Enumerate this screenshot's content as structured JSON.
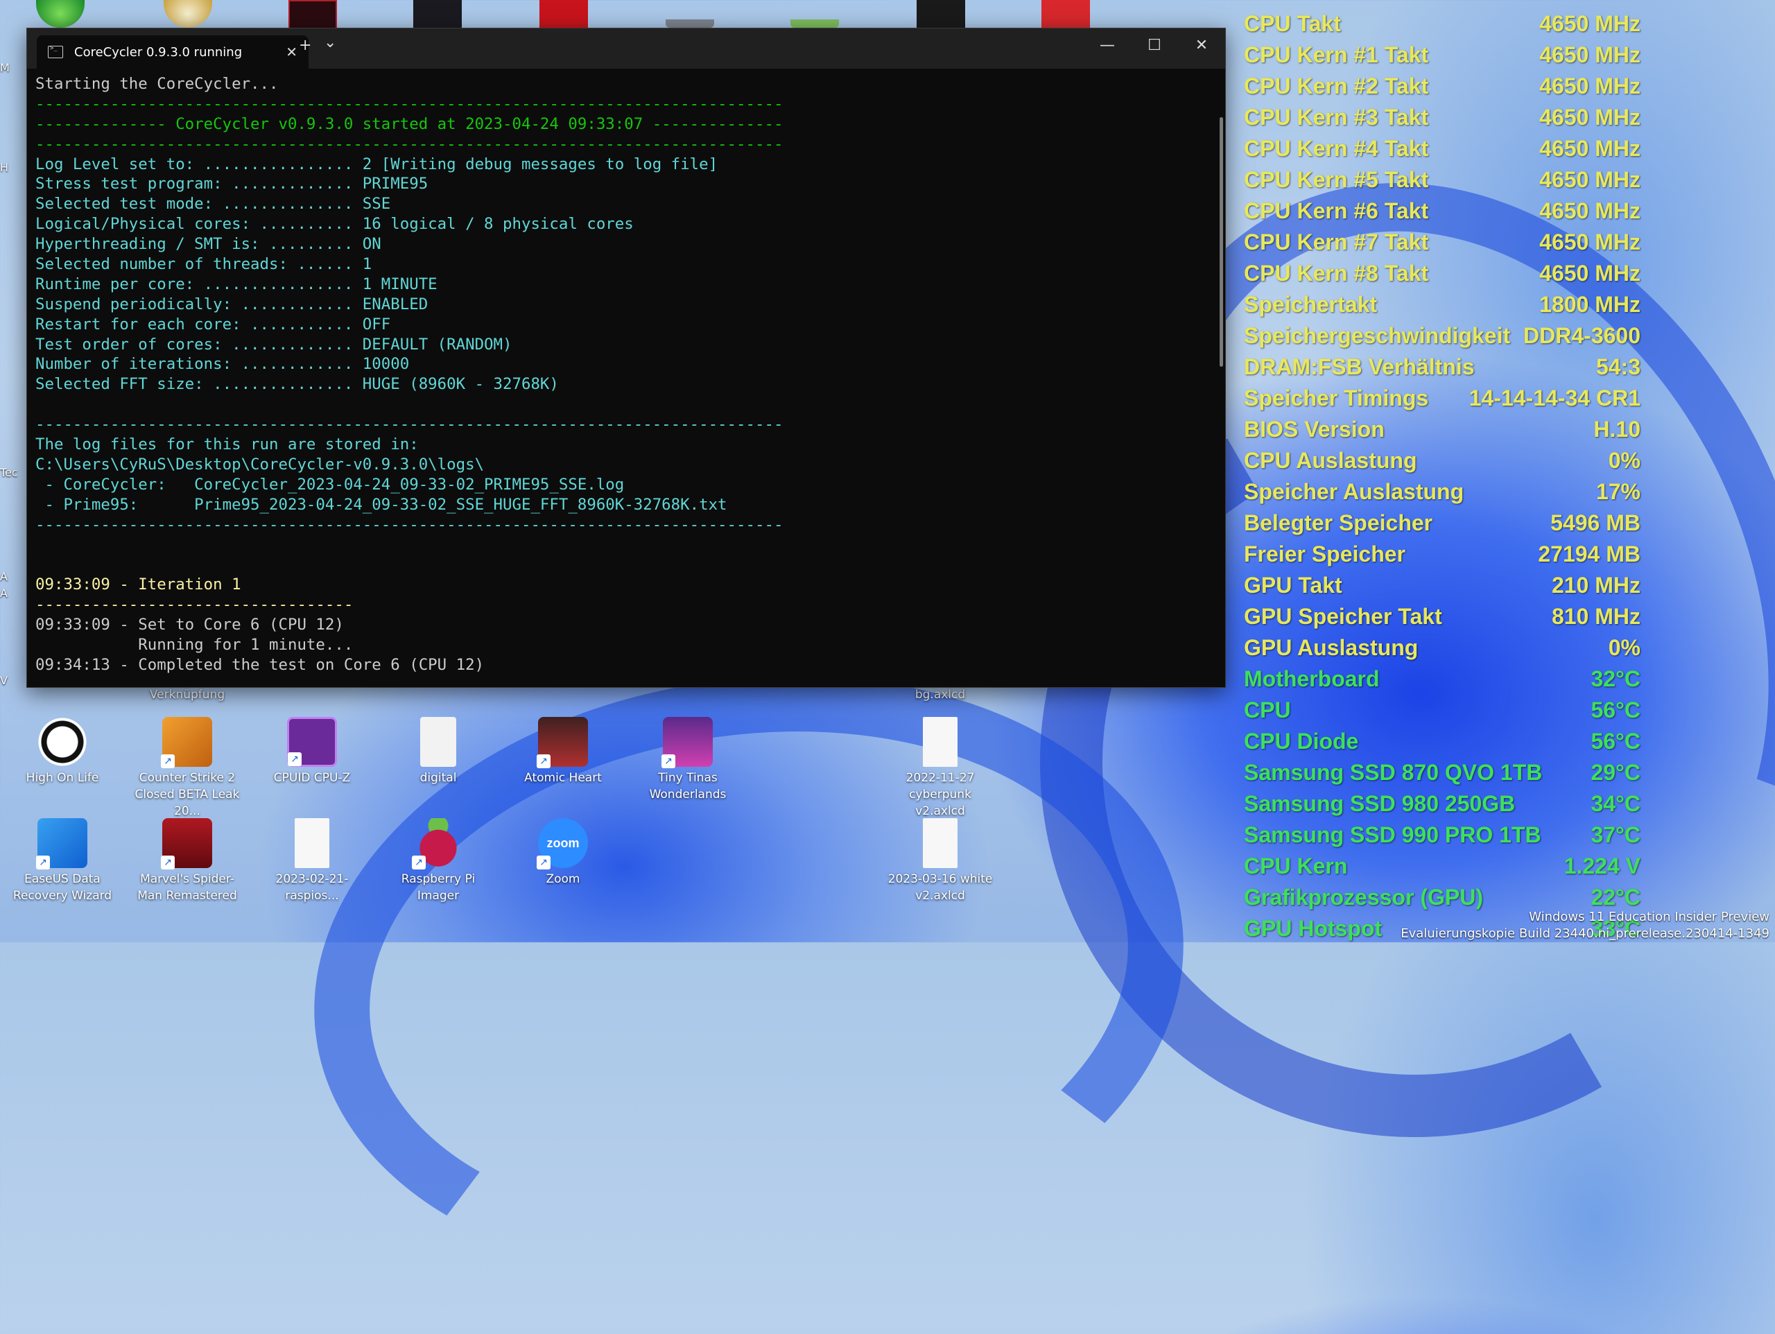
{
  "terminal": {
    "tab_title": "CoreCycler 0.9.3.0 running",
    "new_tab": "+",
    "dropdown": "⌄",
    "close_tab": "✕",
    "minimize": "—",
    "maximize": "☐",
    "close": "✕",
    "lines": [
      {
        "cls": "w",
        "text": "Starting the CoreCycler..."
      },
      {
        "cls": "g",
        "text": "--------------------------------------------------------------------------------"
      },
      {
        "cls": "g",
        "text": "-------------- CoreCycler v0.9.3.0 started at 2023-04-24 09:33:07 --------------"
      },
      {
        "cls": "g",
        "text": "--------------------------------------------------------------------------------"
      },
      {
        "cls": "c",
        "text": "Log Level set to: ................ 2 [Writing debug messages to log file]"
      },
      {
        "cls": "c",
        "text": "Stress test program: ............. PRIME95"
      },
      {
        "cls": "c",
        "text": "Selected test mode: .............. SSE"
      },
      {
        "cls": "c",
        "text": "Logical/Physical cores: .......... 16 logical / 8 physical cores"
      },
      {
        "cls": "c",
        "text": "Hyperthreading / SMT is: ......... ON"
      },
      {
        "cls": "c",
        "text": "Selected number of threads: ...... 1"
      },
      {
        "cls": "c",
        "text": "Runtime per core: ................ 1 MINUTE"
      },
      {
        "cls": "c",
        "text": "Suspend periodically: ............ ENABLED"
      },
      {
        "cls": "c",
        "text": "Restart for each core: ........... OFF"
      },
      {
        "cls": "c",
        "text": "Test order of cores: ............. DEFAULT (RANDOM)"
      },
      {
        "cls": "c",
        "text": "Number of iterations: ............ 10000"
      },
      {
        "cls": "c",
        "text": "Selected FFT size: ............... HUGE (8960K - 32768K)"
      },
      {
        "cls": "c",
        "text": ""
      },
      {
        "cls": "c",
        "text": "--------------------------------------------------------------------------------"
      },
      {
        "cls": "c",
        "text": "The log files for this run are stored in:"
      },
      {
        "cls": "c",
        "text": "C:\\Users\\CyRuS\\Desktop\\CoreCycler-v0.9.3.0\\logs\\"
      },
      {
        "cls": "c",
        "text": " - CoreCycler:   CoreCycler_2023-04-24_09-33-02_PRIME95_SSE.log"
      },
      {
        "cls": "c",
        "text": " - Prime95:      Prime95_2023-04-24_09-33-02_SSE_HUGE_FFT_8960K-32768K.txt"
      },
      {
        "cls": "c",
        "text": "--------------------------------------------------------------------------------"
      },
      {
        "cls": "w",
        "text": ""
      },
      {
        "cls": "w",
        "text": ""
      },
      {
        "cls": "y",
        "text": "09:33:09 - Iteration 1"
      },
      {
        "cls": "y",
        "text": "----------------------------------"
      },
      {
        "cls": "w",
        "text": "09:33:09 - Set to Core 6 (CPU 12)"
      },
      {
        "cls": "w",
        "text": "           Running for 1 minute..."
      },
      {
        "cls": "w",
        "text": "09:34:13 - Completed the test on Core 6 (CPU 12)"
      }
    ]
  },
  "desktop": {
    "under_window_labels": [
      "Verknüpfung",
      "bg.axlcd"
    ],
    "row1": [
      {
        "label": "High On Life",
        "icon": "unreal-icon"
      },
      {
        "label": "Counter Strike 2 Closed BETA Leak 20...",
        "icon": "cs-icon"
      },
      {
        "label": "CPUID CPU-Z",
        "icon": "cpuz-icon"
      },
      {
        "label": "digital",
        "icon": "media-file-icon"
      },
      {
        "label": "Atomic Heart",
        "icon": "atomic-heart-icon"
      },
      {
        "label": "Tiny Tinas Wonderlands",
        "icon": "tiny-tina-icon"
      },
      {
        "label": "2022-11-27 cyberpunk v2.axlcd",
        "icon": "document-icon"
      }
    ],
    "row2": [
      {
        "label": "EaseUS Data Recovery Wizard",
        "icon": "easeus-icon"
      },
      {
        "label": "Marvel's Spider-Man Remastered",
        "icon": "spiderman-icon"
      },
      {
        "label": "2023-02-21-raspios...",
        "icon": "document-icon"
      },
      {
        "label": "Raspberry Pi Imager",
        "icon": "raspberry-icon"
      },
      {
        "label": "Zoom",
        "icon": "zoom-icon"
      },
      {
        "label": "2023-03-16 white v2.axlcd",
        "icon": "document-icon"
      }
    ],
    "zoom_text": "zoom"
  },
  "osd": {
    "rows": [
      {
        "label": "CPU Takt",
        "value": "4650 MHz",
        "color": "yellow"
      },
      {
        "label": "CPU Kern #1 Takt",
        "value": "4650 MHz",
        "color": "yellow"
      },
      {
        "label": "CPU Kern #2 Takt",
        "value": "4650 MHz",
        "color": "yellow"
      },
      {
        "label": "CPU Kern #3 Takt",
        "value": "4650 MHz",
        "color": "yellow"
      },
      {
        "label": "CPU Kern #4 Takt",
        "value": "4650 MHz",
        "color": "yellow"
      },
      {
        "label": "CPU Kern #5 Takt",
        "value": "4650 MHz",
        "color": "yellow"
      },
      {
        "label": "CPU Kern #6 Takt",
        "value": "4650 MHz",
        "color": "yellow"
      },
      {
        "label": "CPU Kern #7 Takt",
        "value": "4650 MHz",
        "color": "yellow"
      },
      {
        "label": "CPU Kern #8 Takt",
        "value": "4650 MHz",
        "color": "yellow"
      },
      {
        "label": "Speichertakt",
        "value": "1800 MHz",
        "color": "yellow"
      },
      {
        "label": "Speichergeschwindigkeit",
        "value": "DDR4-3600",
        "color": "yellow"
      },
      {
        "label": "DRAM:FSB Verhältnis",
        "value": "54:3",
        "color": "yellow"
      },
      {
        "label": "Speicher Timings",
        "value": "14-14-14-34 CR1",
        "color": "yellow"
      },
      {
        "label": "BIOS Version",
        "value": "H.10",
        "color": "yellow"
      },
      {
        "label": "CPU Auslastung",
        "value": "0%",
        "color": "yellow"
      },
      {
        "label": "Speicher Auslastung",
        "value": "17%",
        "color": "yellow"
      },
      {
        "label": "Belegter Speicher",
        "value": "5496 MB",
        "color": "yellow"
      },
      {
        "label": "Freier Speicher",
        "value": "27194 MB",
        "color": "yellow"
      },
      {
        "label": "GPU Takt",
        "value": "210 MHz",
        "color": "yellow"
      },
      {
        "label": "GPU Speicher Takt",
        "value": "810 MHz",
        "color": "yellow"
      },
      {
        "label": "GPU Auslastung",
        "value": "0%",
        "color": "yellow"
      },
      {
        "label": "Motherboard",
        "value": "32°C",
        "color": "green"
      },
      {
        "label": "CPU",
        "value": "56°C",
        "color": "green"
      },
      {
        "label": "CPU Diode",
        "value": "56°C",
        "color": "green"
      },
      {
        "label": "Samsung SSD 870 QVO 1TB",
        "value": "29°C",
        "color": "green"
      },
      {
        "label": "Samsung SSD 980 250GB",
        "value": "34°C",
        "color": "green"
      },
      {
        "label": "Samsung SSD 990 PRO 1TB",
        "value": "37°C",
        "color": "green"
      },
      {
        "label": "CPU Kern",
        "value": "1.224 V",
        "color": "green"
      },
      {
        "label": "Grafikprozessor (GPU)",
        "value": "22°C",
        "color": "green"
      },
      {
        "label": "GPU Hotspot",
        "value": "33°C",
        "color": "green"
      }
    ]
  },
  "watermark": {
    "line1": "Windows 11 Education Insider Preview",
    "line2": "Evaluierungskopie Build 23440.ni_prerelease.230414-1349"
  },
  "colors": {
    "terminal_bg": "#0c0c0c",
    "green": "#16c60c",
    "cyan": "#61d6d6",
    "yellow": "#f9f1a5",
    "osd_yellow": "#e8e85a",
    "osd_green": "#3ee05a"
  }
}
